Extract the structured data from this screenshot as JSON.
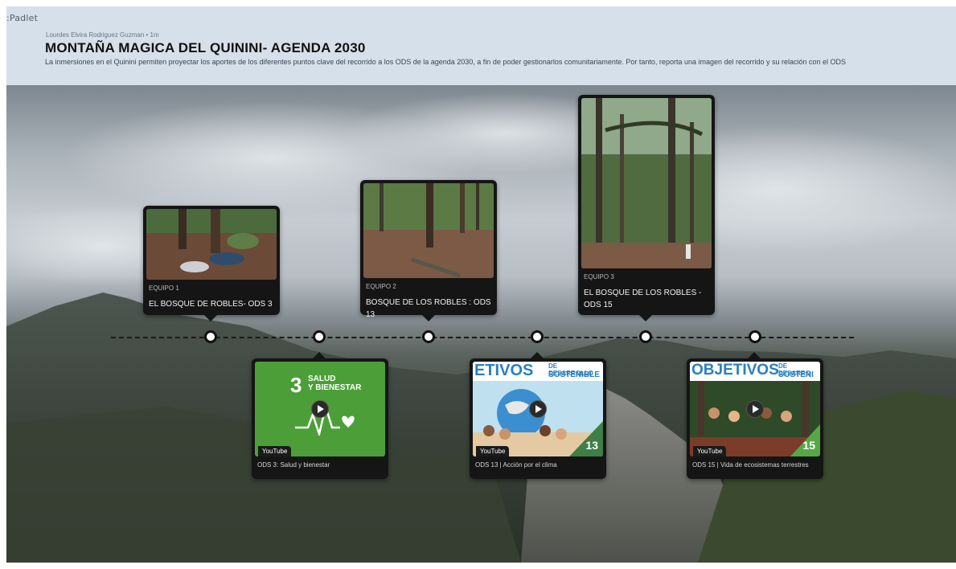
{
  "app": {
    "brand": ":Padlet"
  },
  "header": {
    "author": "Lourdes Elvira Rodriguez Guzman • 1m",
    "title": "MONTAÑA MAGICA DEL QUININI- AGENDA 2030",
    "description": "La inmersiones en el Quinini permiten proyectar los aportes de los diferentes puntos clave del recorrido a los ODS de la agenda 2030, a fin de poder gestionarlos comunitariamente. Por tanto, reporta una imagen del recorrido y su relación con el ODS"
  },
  "posts_top": [
    {
      "team": "EQUIPO 1",
      "caption": "EL BOSQUE DE ROBLES- ODS 3"
    },
    {
      "team": "EQUIPO 2",
      "caption": "BOSQUE DE LOS ROBLES : ODS 13"
    },
    {
      "team": "EQUIPO 3",
      "caption": "EL BOSQUE DE LOS ROBLES - ODS 15"
    }
  ],
  "posts_bottom": [
    {
      "source": "YouTube",
      "caption": "ODS 3: Salud y bienestar",
      "thumb_number": "3",
      "thumb_title_1": "SALUD",
      "thumb_title_2": "Y BIENESTAR"
    },
    {
      "source": "YouTube",
      "caption": "ODS 13 | Acción por el clima",
      "banner_big": "ETIVOS",
      "banner_small_1": "DE DESARROLLO",
      "banner_small_2": "SOSTENIBLE",
      "badge": "13"
    },
    {
      "source": "YouTube",
      "caption": "ODS 15 | Vida de ecosistemas terrestres",
      "banner_big": "OBJETIVOS",
      "banner_small_1": "DE DESARRO",
      "banner_small_2": "SOSTENI",
      "badge": "15"
    }
  ],
  "colors": {
    "header_bg": "#d6e0ea",
    "card_bg": "#151515",
    "ods3_green": "#4c9f38"
  }
}
